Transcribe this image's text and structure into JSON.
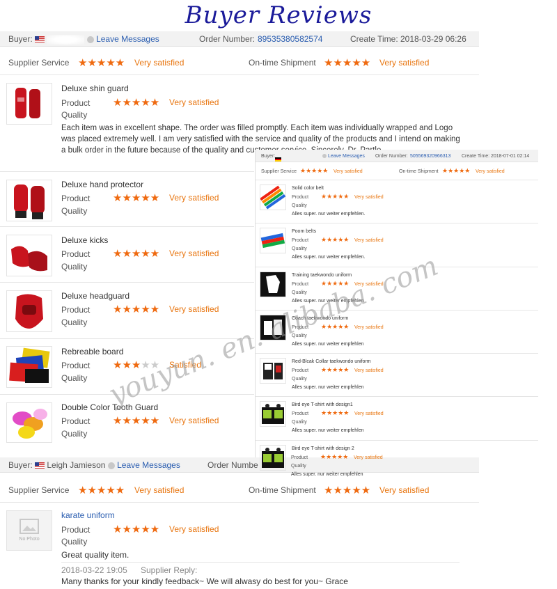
{
  "title": "Buyer Reviews",
  "review1": {
    "buyer_label": "Buyer:",
    "leave_messages": "Leave Messages",
    "order_label": "Order Number:",
    "order_number": "89535380582574",
    "create_label": "Create Time:",
    "create_time": "2018-03-29 06:26",
    "supplier_service": "Supplier Service",
    "on_time_shipment": "On-time Shipment",
    "rating_text": "Very satisfied",
    "product_label": "Product",
    "quality_label": "Quality",
    "comment": "Each item was in excellent shape. The order was filled promptly. Each item was individually wrapped and Logo was placed extremely well. I am very satisfied with the service and quality of the products and I intend on making a bulk order in the future because of the quality and customer service. Sincerely, Dr. Partlo",
    "products": [
      {
        "name": "Deluxe shin guard",
        "rating": "Very satisfied"
      },
      {
        "name": "Deluxe hand protector",
        "rating": "Very satisfied"
      },
      {
        "name": "Deluxe kicks",
        "rating": "Very satisfied"
      },
      {
        "name": "Deluxe headguard",
        "rating": "Very satisfied"
      },
      {
        "name": "Rebreable board",
        "rating": "Satisfied"
      },
      {
        "name": "Double Color Tooth Guard",
        "rating": "Very satisfied"
      }
    ]
  },
  "review2": {
    "buyer_label": "Buyer:",
    "leave_messages": "Leave Messages",
    "order_label": "Order Number:",
    "order_number": "505569320966313",
    "create_label": "Create Time:",
    "create_time": "2018-07-01 02:14",
    "supplier_service": "Supplier Service",
    "on_time_shipment": "On-time Shipment",
    "rating_text": "Very satisfied",
    "product_label": "Product",
    "quality_label": "Quality",
    "comment": "Alles super. nur weiter empfehlen.",
    "products": [
      {
        "name": "Solid color belt",
        "comment": "Alles super. nur weiter empfehlen."
      },
      {
        "name": "Poom belts",
        "comment": "Alles super. nur weiter empfehlen."
      },
      {
        "name": "Training taekwondo uniform",
        "comment": "Alles super. nur weiter empfehlen"
      },
      {
        "name": "Coach taekwondo uniform",
        "comment": "Alles super. nur weiter empfehlen"
      },
      {
        "name": "Red-Blcak Collar taekwondo uniform",
        "comment": "Alles super. nur weiter empfehlen"
      },
      {
        "name": "Bird eye T-shirt with design1",
        "comment": "Alles super. nur weiter empfehlen"
      },
      {
        "name": "Bird eye T-shirt with design 2",
        "comment": "Alles super. nur weiter empfehlen"
      }
    ]
  },
  "review3": {
    "buyer_label": "Buyer:",
    "buyer_name": "Leigh Jamieson",
    "leave_messages": "Leave Messages",
    "order_label": "Order Numbe",
    "supplier_service": "Supplier Service",
    "on_time_shipment": "On-time Shipment",
    "rating_text": "Very satisfied",
    "product_name": "karate uniform",
    "product_label": "Product",
    "quality_label": "Quality",
    "no_photo": "No Photo",
    "comment": "Great quality item.",
    "reply_time": "2018-03-22 19:05",
    "reply_label": "Supplier Reply:",
    "reply_text": "Many thanks for your kindly feedback~ We will alwasy do best for you~ Grace"
  },
  "stars": {
    "full": "★★★★★",
    "three_filled": "★★★",
    "two_empty": "★★"
  },
  "watermark": "youyun. en. alibaba. com",
  "colors": {
    "title": "#1b1b9a",
    "star": "#ef6a10",
    "link": "#2a5db0",
    "satisfied": "#e8750f"
  }
}
